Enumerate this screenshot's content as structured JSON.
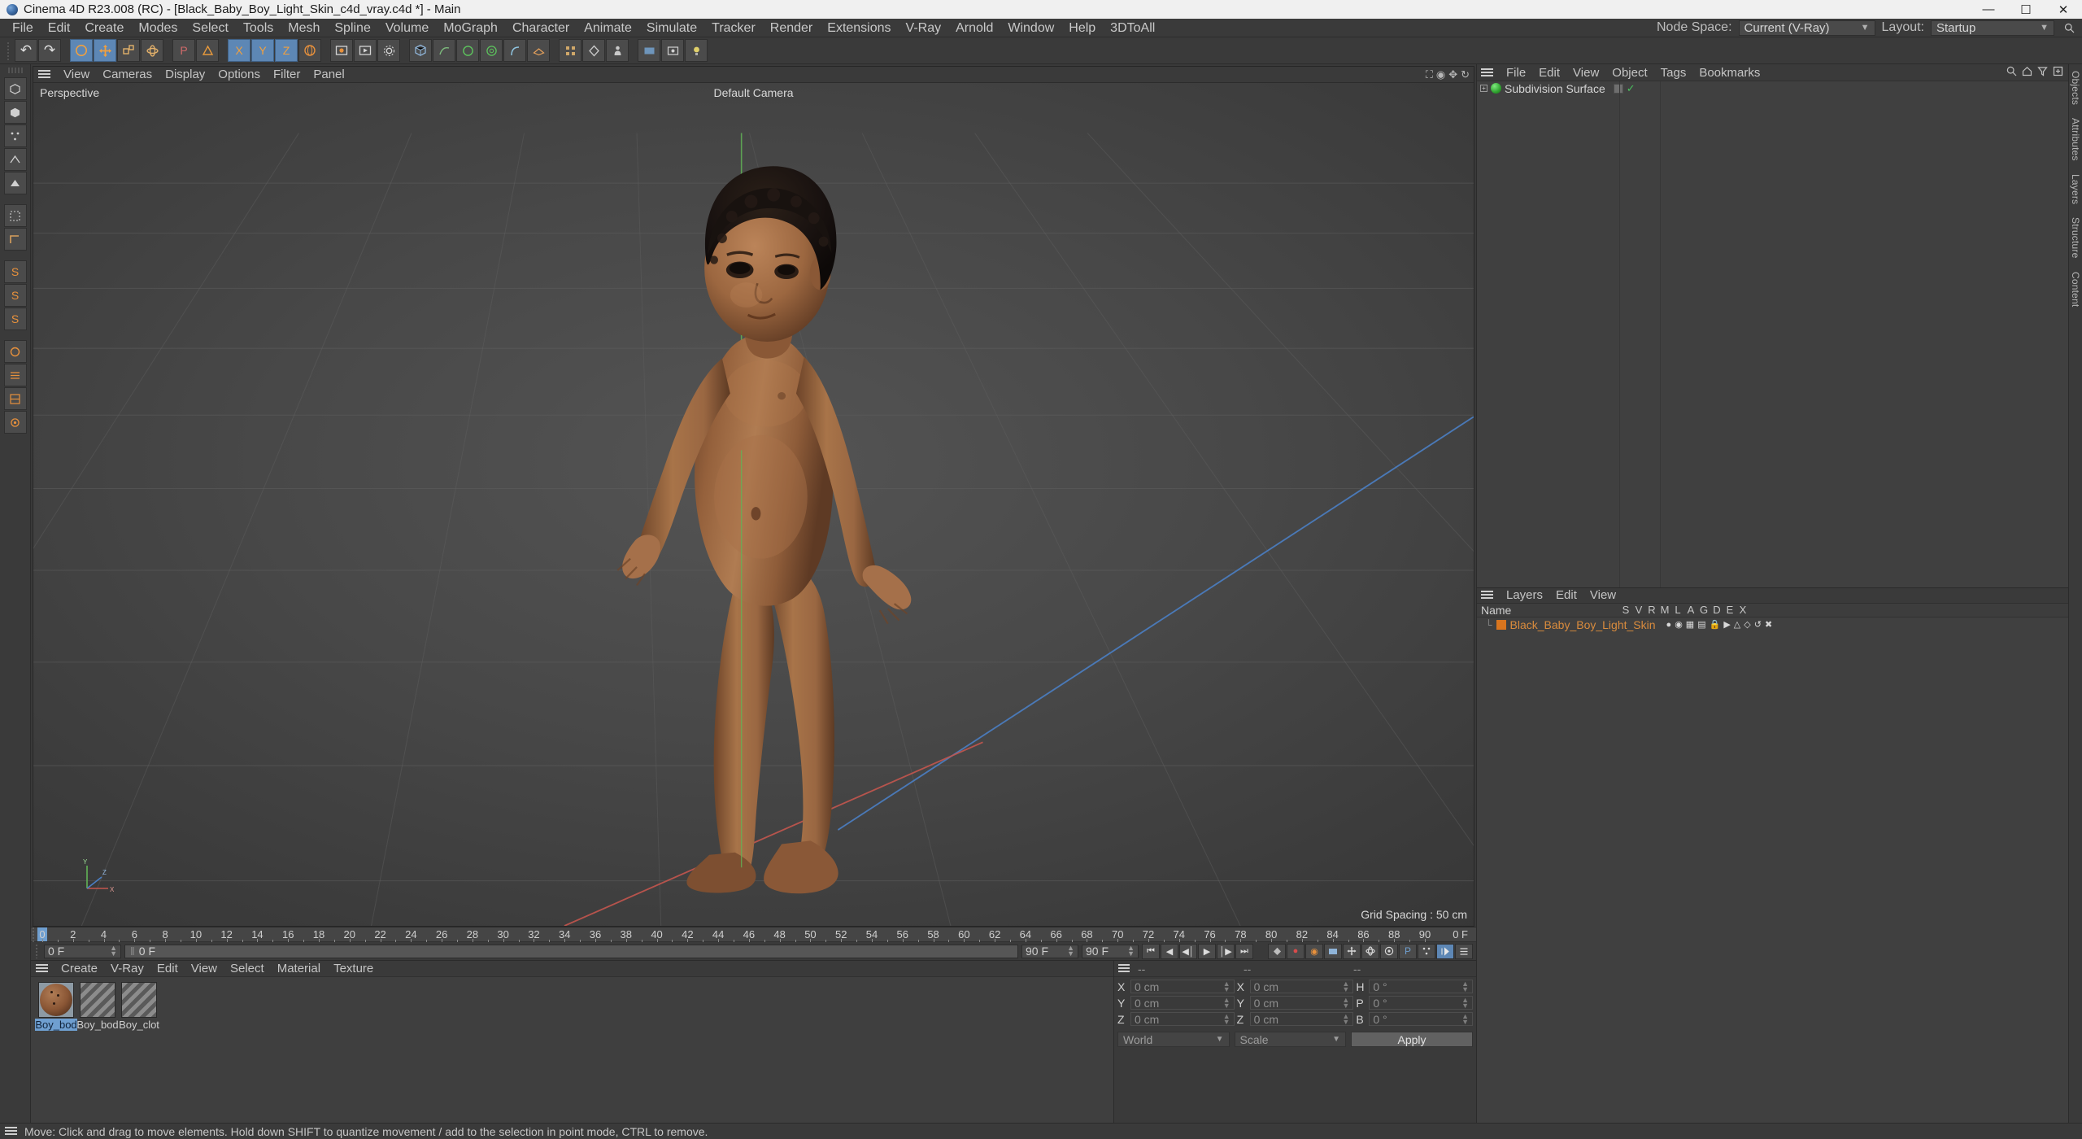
{
  "titlebar": {
    "title": "Cinema 4D R23.008 (RC) - [Black_Baby_Boy_Light_Skin_c4d_vray.c4d *] - Main",
    "minimize": "—",
    "maximize": "☐",
    "close": "✕",
    "logo_icon": "cinema4d-logo-icon"
  },
  "menubar": {
    "items": [
      {
        "label": "File"
      },
      {
        "label": "Edit"
      },
      {
        "label": "Create"
      },
      {
        "label": "Modes"
      },
      {
        "label": "Select"
      },
      {
        "label": "Tools"
      },
      {
        "label": "Mesh"
      },
      {
        "label": "Spline"
      },
      {
        "label": "Volume"
      },
      {
        "label": "MoGraph"
      },
      {
        "label": "Character"
      },
      {
        "label": "Animate"
      },
      {
        "label": "Simulate"
      },
      {
        "label": "Tracker"
      },
      {
        "label": "Render"
      },
      {
        "label": "Extensions"
      },
      {
        "label": "V-Ray"
      },
      {
        "label": "Arnold"
      },
      {
        "label": "Window"
      },
      {
        "label": "Help"
      },
      {
        "label": "3DToAll"
      }
    ],
    "node_space_label": "Node Space:",
    "node_space_value": "Current (V-Ray)",
    "layout_label": "Layout:",
    "layout_value": "Startup",
    "search_icon": "search-icon"
  },
  "toolbar": {
    "groups": [
      {
        "buttons": [
          {
            "name": "undo-button",
            "glyph": "↶",
            "state": "normal"
          },
          {
            "name": "redo-button",
            "glyph": "↷",
            "state": "normal"
          }
        ]
      },
      {
        "buttons": [
          {
            "name": "live-selection-tool",
            "glyph": "◎",
            "state": "selected"
          },
          {
            "name": "move-tool",
            "glyph": "✥",
            "state": "selected"
          },
          {
            "name": "scale-tool",
            "glyph": "⤡",
            "state": "normal"
          },
          {
            "name": "rotate-tool",
            "glyph": "↻",
            "state": "normal"
          },
          {
            "name": "dynamic-place-tool",
            "glyph": "▦",
            "state": "normal"
          },
          {
            "name": "world-axis-tool",
            "glyph": "⬚",
            "state": "orange"
          }
        ]
      },
      {
        "buttons": [
          {
            "name": "lock-x-axis",
            "glyph": "X",
            "state": "orange"
          },
          {
            "name": "lock-y-axis",
            "glyph": "Y",
            "state": "orange"
          },
          {
            "name": "lock-z-axis",
            "glyph": "Z",
            "state": "orange"
          },
          {
            "name": "world-coordinate-toggle",
            "glyph": "⬡",
            "state": "normal"
          }
        ]
      },
      {
        "buttons": [
          {
            "name": "render-view-button",
            "glyph": "▣",
            "state": "normal"
          },
          {
            "name": "render-to-picture-viewer-button",
            "glyph": "▶",
            "state": "normal"
          },
          {
            "name": "render-settings-button",
            "glyph": "⚙",
            "state": "normal"
          }
        ]
      },
      {
        "buttons": [
          {
            "name": "cube-primitive-button",
            "glyph": "▢",
            "state": "normal"
          },
          {
            "name": "spline-pen-button",
            "glyph": "✎",
            "state": "normal"
          },
          {
            "name": "subdivision-surface-button",
            "glyph": "⬢",
            "state": "normal"
          },
          {
            "name": "array-generator-button",
            "glyph": "⊞",
            "state": "normal"
          },
          {
            "name": "bend-deformer-button",
            "glyph": "◔",
            "state": "normal"
          },
          {
            "name": "floor-object-button",
            "glyph": "▭",
            "state": "normal"
          }
        ]
      },
      {
        "buttons": [
          {
            "name": "camera-object-button",
            "glyph": "△",
            "state": "normal"
          },
          {
            "name": "light-object-button",
            "glyph": "●",
            "state": "normal"
          }
        ]
      },
      {
        "buttons": [
          {
            "name": "mograph-cloner-button",
            "glyph": "∴",
            "state": "normal"
          },
          {
            "name": "field-object-button",
            "glyph": "◈",
            "state": "normal"
          }
        ]
      },
      {
        "buttons": [
          {
            "name": "vray-render-button",
            "glyph": "■",
            "state": "normal"
          },
          {
            "name": "vray-frame-buffer-button",
            "glyph": "▤",
            "state": "normal"
          },
          {
            "name": "vray-light-button",
            "glyph": "☀",
            "state": "normal"
          }
        ]
      }
    ]
  },
  "left_palette": {
    "buttons": [
      {
        "name": "model-mode-button",
        "glyph": "▢",
        "state": "normal"
      },
      {
        "name": "texture-mode-button",
        "glyph": "◩",
        "state": "selected"
      },
      {
        "name": "points-mode-button",
        "glyph": "⁙",
        "state": "normal"
      },
      {
        "name": "edges-mode-button",
        "glyph": "▱",
        "state": "normal"
      },
      {
        "name": "polygons-mode-button",
        "glyph": "◆",
        "state": "normal"
      },
      {
        "name": "enable-axis-button",
        "glyph": "⬚",
        "state": "normal"
      },
      {
        "name": "workplane-button",
        "glyph": "⌐",
        "state": "normal"
      },
      {
        "name": "snap-settings-button",
        "glyph": "S",
        "state": "orange"
      },
      {
        "name": "quantize-button",
        "glyph": "S",
        "state": "orange"
      },
      {
        "name": "workplane-lock-button",
        "glyph": "S",
        "state": "orange"
      },
      {
        "name": "viewport-solo-button",
        "glyph": "⬡",
        "state": "orange"
      },
      {
        "name": "layer-visibility-button",
        "glyph": "≡",
        "state": "orange"
      },
      {
        "name": "filter-button",
        "glyph": "◧",
        "state": "orange"
      },
      {
        "name": "project-asset-button",
        "glyph": "⬟",
        "state": "orange"
      }
    ]
  },
  "viewport": {
    "menu": [
      {
        "label": "View"
      },
      {
        "label": "Cameras"
      },
      {
        "label": "Display"
      },
      {
        "label": "Options"
      },
      {
        "label": "Filter"
      },
      {
        "label": "Panel"
      }
    ],
    "hamburger_icon": "hamburger-icon",
    "corner_icons": [
      "viewport-maximize-icon",
      "viewport-camera-icon",
      "viewport-move-icon",
      "viewport-rotate-icon"
    ],
    "projection_label": "Perspective",
    "camera_label": "Default Camera",
    "grid_spacing_label": "Grid Spacing : 50 cm",
    "axis_labels": {
      "x": "X",
      "y": "Y",
      "z": "Z"
    },
    "colors": {
      "x_axis": "#c4564e",
      "y_axis": "#62b356",
      "z_axis": "#4b7fc4",
      "grid": "#5b5b5b"
    },
    "model_name": "baby-boy-character"
  },
  "timeline": {
    "ticks": [
      "0",
      "2",
      "4",
      "6",
      "8",
      "10",
      "12",
      "14",
      "16",
      "18",
      "20",
      "22",
      "24",
      "26",
      "28",
      "30",
      "32",
      "34",
      "36",
      "38",
      "40",
      "42",
      "44",
      "46",
      "48",
      "50",
      "52",
      "54",
      "56",
      "58",
      "60",
      "62",
      "64",
      "66",
      "68",
      "70",
      "72",
      "74",
      "76",
      "78",
      "80",
      "82",
      "84",
      "86",
      "88",
      "90"
    ],
    "end_label": "0 F",
    "current_frame_field": "0 F",
    "current_frame_readout": "0 F",
    "range_start": "90 F",
    "range_end": "90 F",
    "transport": [
      {
        "name": "go-to-start-button",
        "glyph": "⏮"
      },
      {
        "name": "play-backwards-button",
        "glyph": "◀"
      },
      {
        "name": "previous-frame-button",
        "glyph": "◀│"
      },
      {
        "name": "play-forwards-button",
        "glyph": "▶"
      },
      {
        "name": "next-frame-button",
        "glyph": "│▶"
      },
      {
        "name": "go-to-end-button",
        "glyph": "⏭"
      }
    ],
    "record_buttons": [
      {
        "name": "record-active-objects-button",
        "glyph": "●",
        "state": "red"
      },
      {
        "name": "autokeying-button",
        "glyph": "◉",
        "state": "orange"
      },
      {
        "name": "keyframe-selection-button",
        "glyph": "▣",
        "state": "normal"
      },
      {
        "name": "position-key-button",
        "glyph": "✥",
        "state": "normal"
      },
      {
        "name": "rotation-key-button",
        "glyph": "↻",
        "state": "normal"
      },
      {
        "name": "scale-key-button",
        "glyph": "⤡",
        "state": "normal"
      },
      {
        "name": "parameter-key-button",
        "glyph": "P",
        "state": "normal"
      },
      {
        "name": "point-level-animation-button",
        "glyph": "⁙",
        "state": "normal"
      },
      {
        "name": "playback-mode-button",
        "glyph": "▷",
        "state": "selected"
      },
      {
        "name": "timeline-settings-button",
        "glyph": "☰",
        "state": "normal"
      }
    ]
  },
  "material_manager": {
    "hamburger_icon": "hamburger-icon",
    "menu": [
      {
        "label": "Create"
      },
      {
        "label": "V-Ray"
      },
      {
        "label": "Edit"
      },
      {
        "label": "View"
      },
      {
        "label": "Select"
      },
      {
        "label": "Material"
      },
      {
        "label": "Texture"
      }
    ],
    "materials": [
      {
        "label": "Boy_bod",
        "thumb": "skin",
        "selected": true
      },
      {
        "label": "Boy_bod",
        "thumb": "checker",
        "selected": false
      },
      {
        "label": "Boy_clot",
        "thumb": "checker",
        "selected": false
      }
    ]
  },
  "coordinates": {
    "hamburger_icon": "hamburger-icon",
    "headers": [
      "--",
      "--",
      "--"
    ],
    "position": [
      {
        "label": "X",
        "value": "0 cm"
      },
      {
        "label": "Y",
        "value": "0 cm"
      },
      {
        "label": "Z",
        "value": "0 cm"
      }
    ],
    "size": [
      {
        "label": "X",
        "value": "0 cm"
      },
      {
        "label": "Y",
        "value": "0 cm"
      },
      {
        "label": "Z",
        "value": "0 cm"
      }
    ],
    "rotation": [
      {
        "label": "H",
        "value": "0 °"
      },
      {
        "label": "P",
        "value": "0 °"
      },
      {
        "label": "B",
        "value": "0 °"
      }
    ],
    "coord_system": "World",
    "size_mode": "Scale",
    "apply_label": "Apply"
  },
  "object_manager": {
    "hamburger_icon": "hamburger-icon",
    "menu": [
      {
        "label": "File"
      },
      {
        "label": "Edit"
      },
      {
        "label": "View"
      },
      {
        "label": "Object"
      },
      {
        "label": "Tags"
      },
      {
        "label": "Bookmarks"
      }
    ],
    "icons": [
      "search-icon",
      "home-icon",
      "filter-icon",
      "add-icon"
    ],
    "objects": [
      {
        "name": "Subdivision Surface",
        "expandable": true,
        "tag_icon": "phong-tag-icon",
        "enabled_icon": "check-icon"
      }
    ]
  },
  "layer_manager": {
    "hamburger_icon": "hamburger-icon",
    "menu": [
      {
        "label": "Layers"
      },
      {
        "label": "Edit"
      },
      {
        "label": "View"
      }
    ],
    "columns": [
      "Name",
      "S",
      "V",
      "R",
      "M",
      "L",
      "A",
      "G",
      "D",
      "E",
      "X"
    ],
    "layers": [
      {
        "name": "Black_Baby_Boy_Light_Skin",
        "color": "#d9751e",
        "toggles": [
          "solo-icon",
          "view-icon",
          "render-icon",
          "manager-icon",
          "lock-icon",
          "animation-icon",
          "generator-icon",
          "deformer-icon",
          "expression-icon",
          "xpresso-icon"
        ]
      }
    ]
  },
  "right_tabs": [
    {
      "label": "Objects"
    },
    {
      "label": "Attributes"
    },
    {
      "label": "Layers"
    },
    {
      "label": "Structure"
    },
    {
      "label": "Content"
    }
  ],
  "statusbar": {
    "hamburger_icon": "hamburger-icon",
    "message": "Move: Click and drag to move elements. Hold down SHIFT to quantize movement / add to the selection in point mode, CTRL to remove."
  }
}
